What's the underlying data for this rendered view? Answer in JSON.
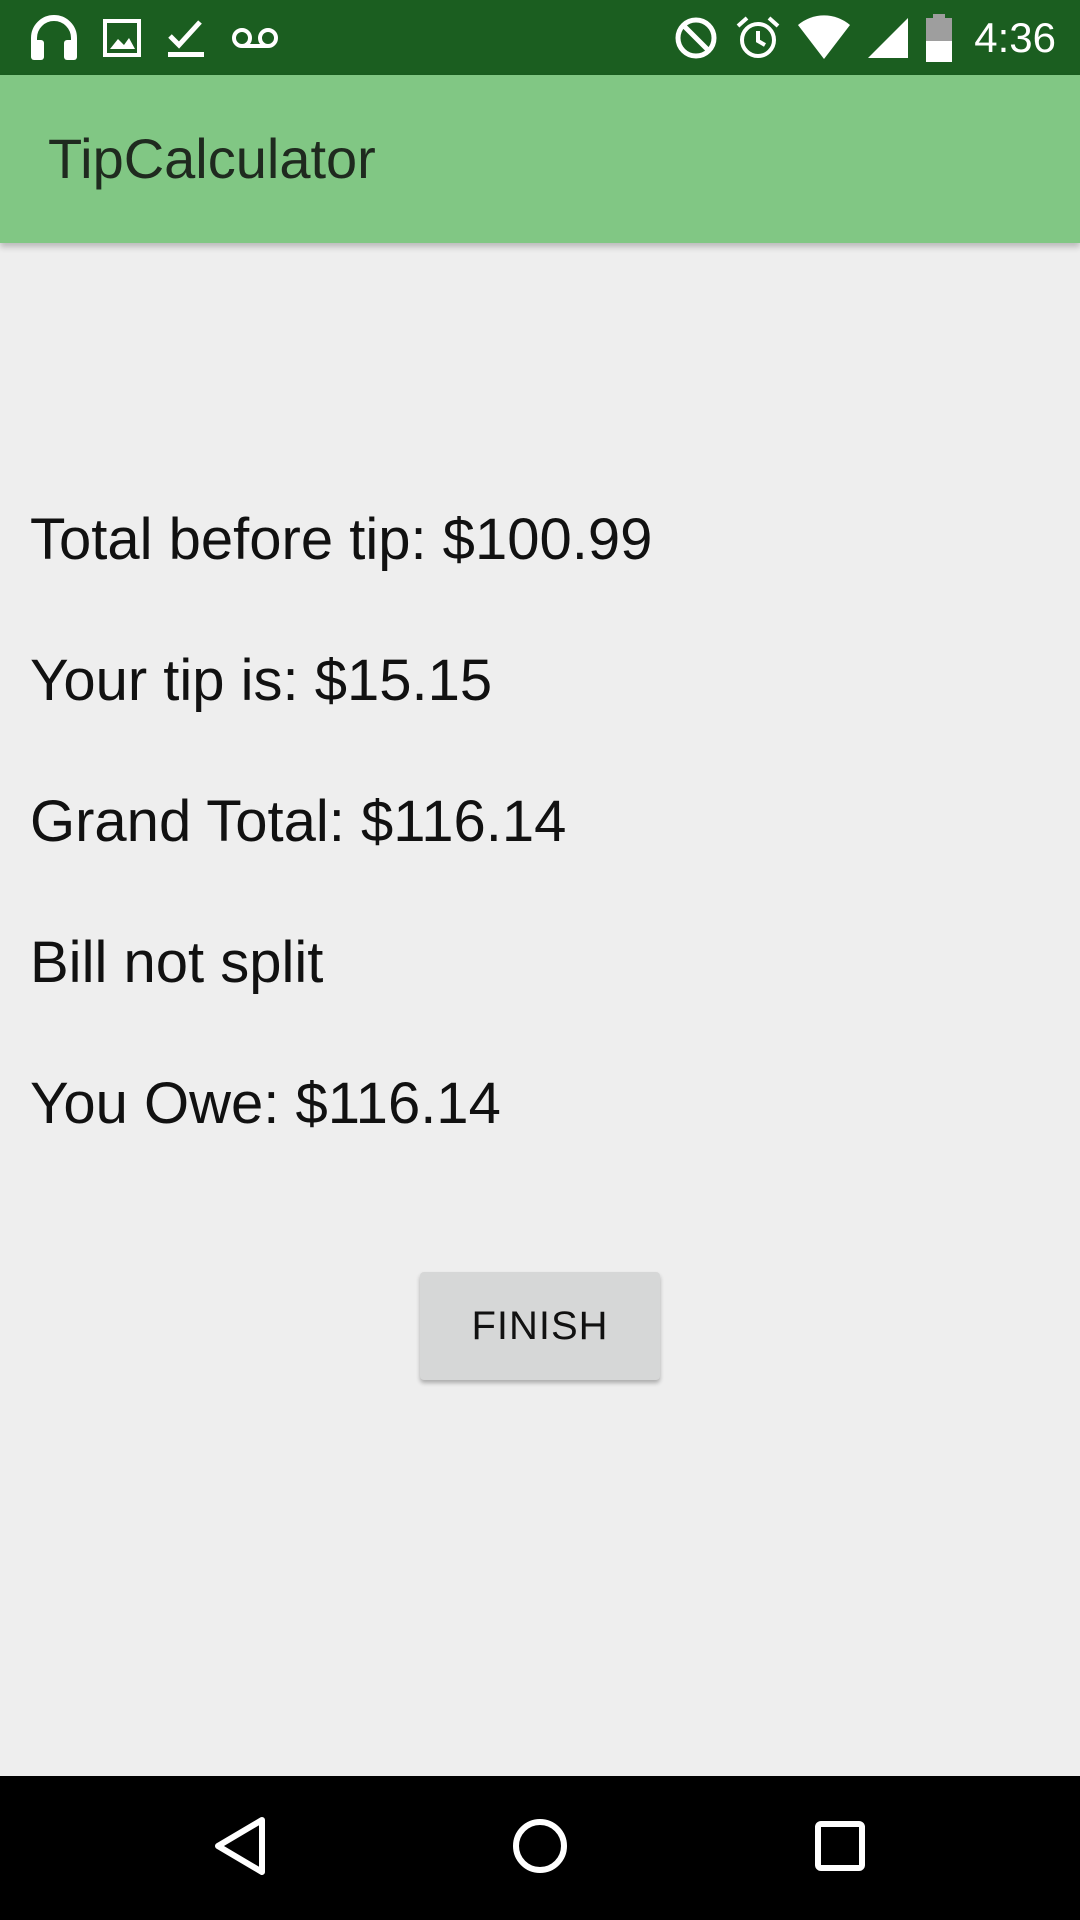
{
  "status_bar": {
    "time": "4:36",
    "left_icons": [
      "headphones-icon",
      "image-icon",
      "check-icon",
      "voicemail-icon"
    ],
    "right_icons": [
      "do-not-disturb-icon",
      "alarm-icon",
      "wifi-icon",
      "cell-signal-icon",
      "battery-icon"
    ]
  },
  "app_bar": {
    "title": "TipCalculator",
    "color": "#81c784"
  },
  "results": {
    "total_before_tip": "Total before tip: $100.99",
    "tip": "Your tip is: $15.15",
    "grand_total": "Grand Total: $116.14",
    "split_status": "Bill not split",
    "you_owe": "You Owe: $116.14"
  },
  "actions": {
    "finish_label": "FINISH"
  },
  "nav_bar": {
    "buttons": [
      "back-icon",
      "home-icon",
      "recents-icon"
    ]
  },
  "colors": {
    "status_bar": "#1b5e20",
    "background": "#eeeeee",
    "button": "#d6d7d7"
  }
}
